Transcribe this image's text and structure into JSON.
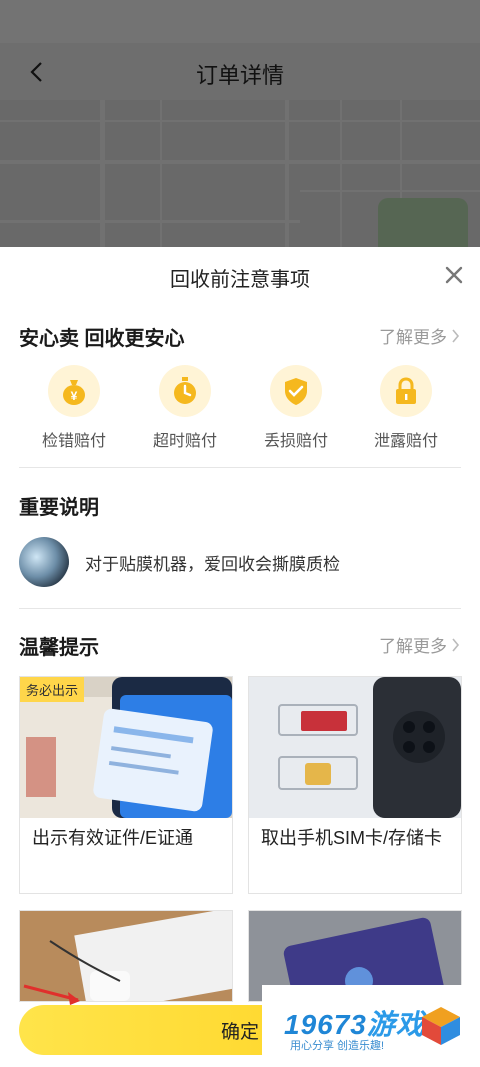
{
  "header": {
    "title": "订单详情"
  },
  "sheet": {
    "title": "回收前注意事项",
    "safe_section": {
      "title": "安心卖 回收更安心",
      "more": "了解更多",
      "items": [
        {
          "label": "检错赔付",
          "icon": "money-bag-icon"
        },
        {
          "label": "超时赔付",
          "icon": "stopwatch-icon"
        },
        {
          "label": "丢损赔付",
          "icon": "shield-check-icon"
        },
        {
          "label": "泄露赔付",
          "icon": "lock-icon"
        }
      ]
    },
    "important_section": {
      "title": "重要说明",
      "note": "对于贴膜机器，爱回收会撕膜质检"
    },
    "tips_section": {
      "title": "温馨提示",
      "more": "了解更多",
      "cards": [
        {
          "label": "出示有效证件/E证通",
          "badge": "务必出示"
        },
        {
          "label": "取出手机SIM卡/存储卡"
        }
      ]
    },
    "confirm": "确定"
  },
  "watermark": {
    "number": "19673",
    "name": "游戏",
    "slogan": "用心分享 创造乐趣!"
  },
  "colors": {
    "accent": "#ffd21f",
    "icon_gold": "#f5b81e"
  }
}
